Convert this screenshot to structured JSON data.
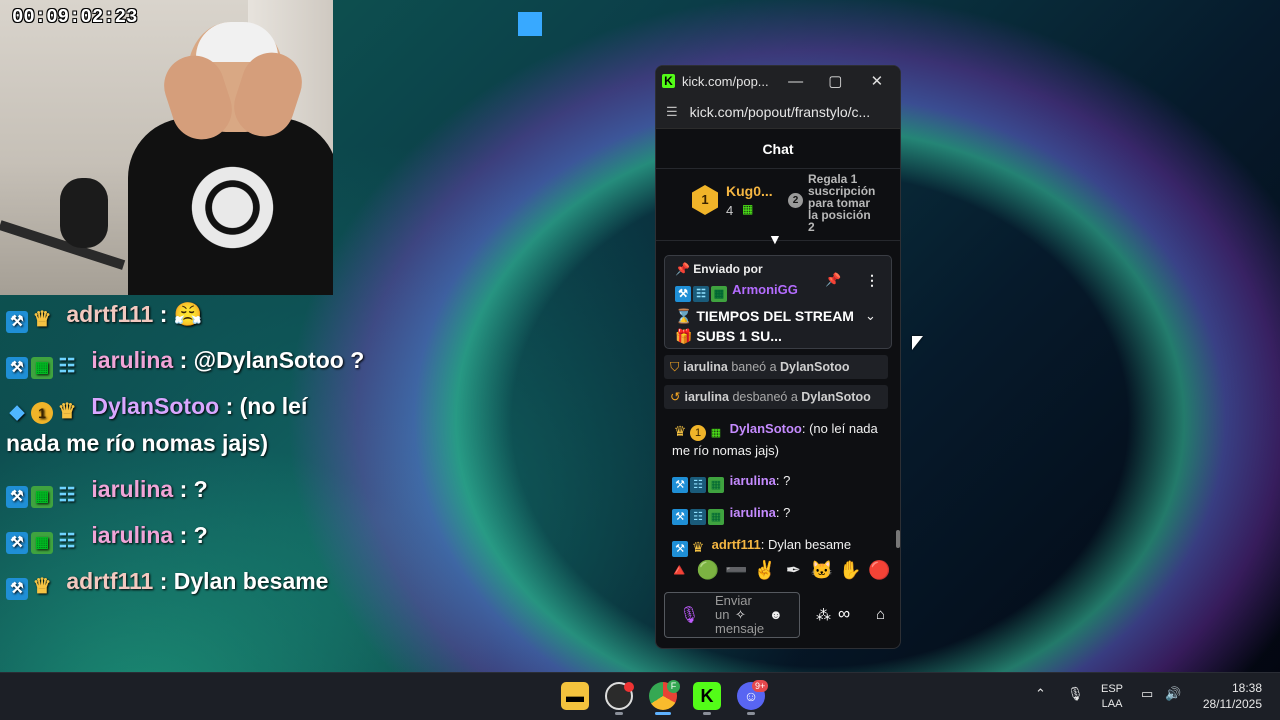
{
  "webcam": {
    "timer": "00:09:02:23"
  },
  "overlay_chat": [
    {
      "badges": [
        "mod",
        "crown"
      ],
      "user": "adrtf111",
      "text": ": 😤",
      "color": "#f2c9c0"
    },
    {
      "badges": [
        "mod",
        "creep",
        "sub"
      ],
      "user": "iarulina",
      "text": ": @DylanSotoo ?",
      "color": "#f0a5d8"
    },
    {
      "badges": [
        "cube",
        "one",
        "crown"
      ],
      "user": "DylanSotoo",
      "text": ": (no leí",
      "continuation": "nada me río nomas jajs)",
      "color": "#d9a7ff"
    },
    {
      "badges": [
        "mod",
        "creep",
        "sub"
      ],
      "user": "iarulina",
      "text": ": ?",
      "color": "#f0a5d8"
    },
    {
      "badges": [
        "mod",
        "creep",
        "sub"
      ],
      "user": "iarulina",
      "text": ": ?",
      "color": "#f0a5d8"
    },
    {
      "badges": [
        "mod",
        "crown"
      ],
      "user": "adrtf111",
      "text": ": Dylan besame",
      "color": "#f2c9c0"
    }
  ],
  "browser": {
    "tab_title": "kick.com/pop...",
    "url": "kick.com/popout/franstylo/c...",
    "chat_title": "Chat",
    "leaderboard": {
      "rank1_medal": "1",
      "rank1_name": "Kug0...",
      "rank1_count": "4",
      "rank2_medal": "2",
      "rank2_text": "Regala 1 suscripción para tomar la posición 2"
    },
    "pinned": {
      "by_label": "Enviado por",
      "author": "ArmoniGG",
      "text": "⌛ TIEMPOS DEL STREAM 🎁 SUBS 1 SU..."
    },
    "system_messages": [
      {
        "actor": "iarulina",
        "action": "baneó a",
        "target": "DylanSotoo"
      },
      {
        "actor": "iarulina",
        "action": "desbaneó a",
        "target": "DylanSotoo"
      }
    ],
    "messages": [
      {
        "badges": [
          "crown",
          "one",
          "gift"
        ],
        "user": "DylanSotoo",
        "text": "(no leí nada me río nomas jajs)",
        "color": "#c58bff"
      },
      {
        "badges": [
          "mod",
          "sub",
          "creep"
        ],
        "user": "iarulina",
        "text": "?",
        "color": "#c58bff"
      },
      {
        "badges": [
          "mod",
          "sub",
          "creep"
        ],
        "user": "iarulina",
        "text": "?",
        "color": "#c58bff"
      },
      {
        "badges": [
          "mod",
          "crown"
        ],
        "user": "adrtf111",
        "text": "Dylan besame",
        "color": "#f5b642"
      }
    ],
    "input_placeholder": "Enviar un mensaje",
    "infinity": "∞"
  },
  "taskbar": {
    "discord_badge": "9+",
    "chrome_badge": "F",
    "lang_top": "ESP",
    "lang_bottom": "LAA",
    "time": "18:38",
    "date": "28/11/2025"
  }
}
